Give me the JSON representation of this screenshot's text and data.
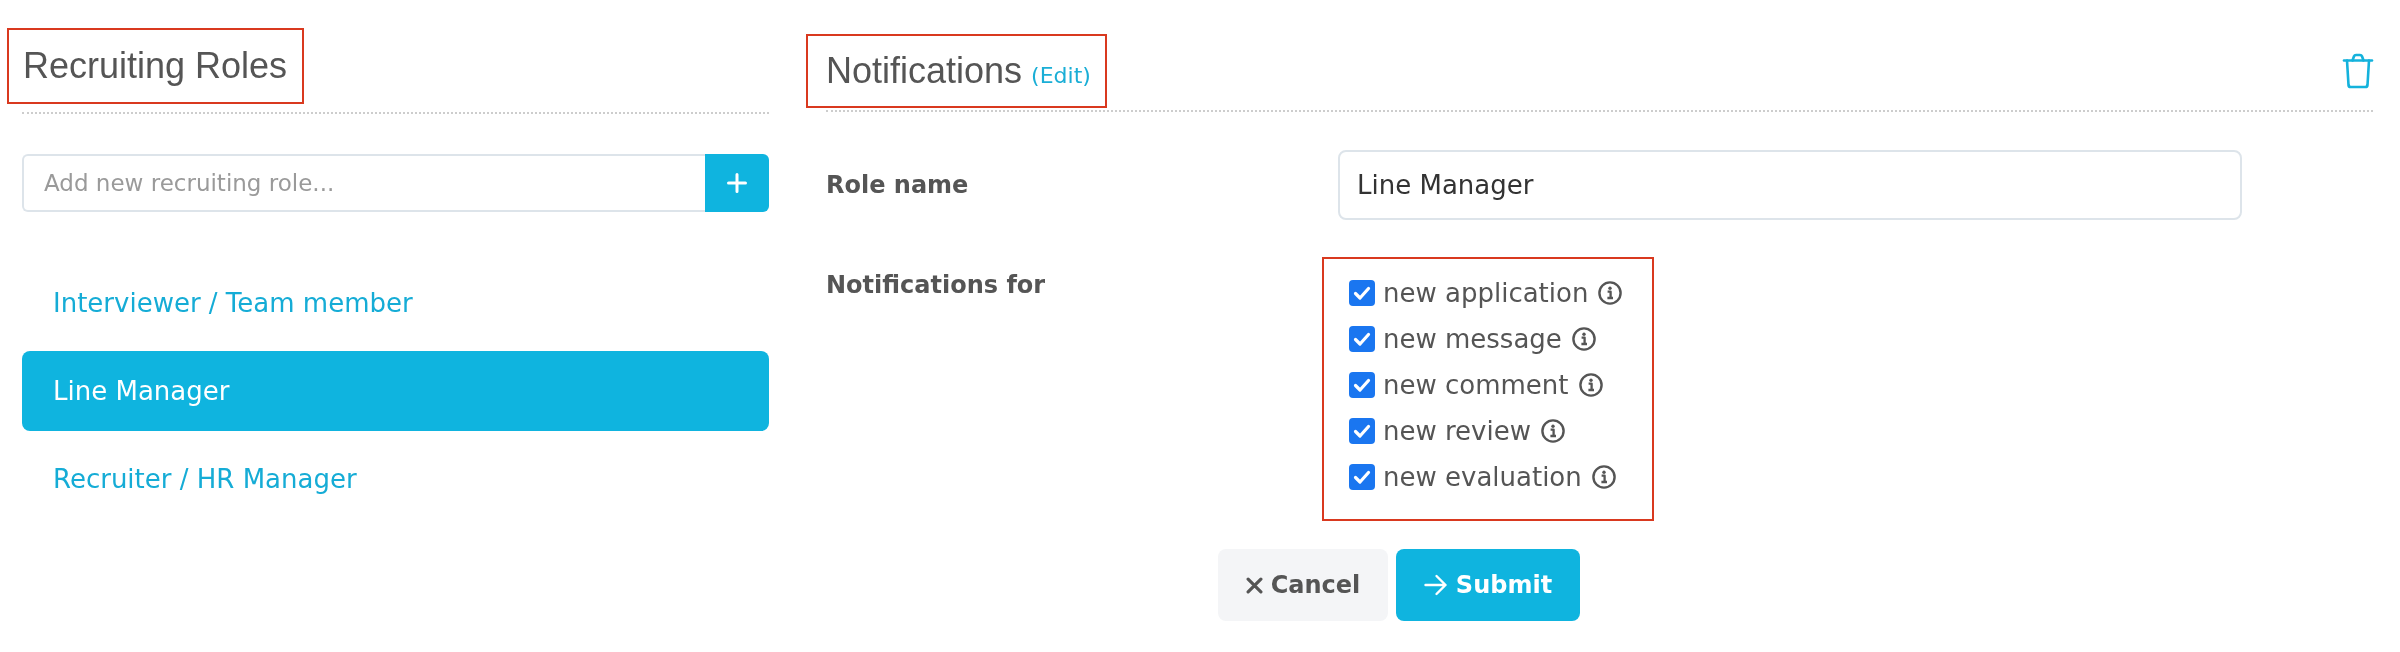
{
  "roles_panel": {
    "title": "Recruiting Roles",
    "highlighted": true,
    "add_field": {
      "placeholder": "Add new recruiting role..."
    },
    "roles": [
      {
        "label": "Interviewer / Team member",
        "selected": false
      },
      {
        "label": "Line Manager",
        "selected": true
      },
      {
        "label": "Recruiter / HR Manager",
        "selected": false
      }
    ]
  },
  "details_panel": {
    "title": "Notifications",
    "edit_link": "(Edit)",
    "highlighted": true,
    "fields": [
      {
        "kind": "text",
        "label": "Role name",
        "value": "Line Manager"
      },
      {
        "kind": "checklist",
        "label": "Notifications for",
        "highlighted": true,
        "options": [
          {
            "label": "new application",
            "checked": true
          },
          {
            "label": "new message",
            "checked": true
          },
          {
            "label": "new comment",
            "checked": true
          },
          {
            "label": "new review",
            "checked": true
          },
          {
            "label": "new evaluation",
            "checked": true
          }
        ]
      }
    ],
    "buttons": [
      {
        "kind": "cancel",
        "label": "Cancel"
      },
      {
        "kind": "submit",
        "label": "Submit"
      }
    ]
  }
}
